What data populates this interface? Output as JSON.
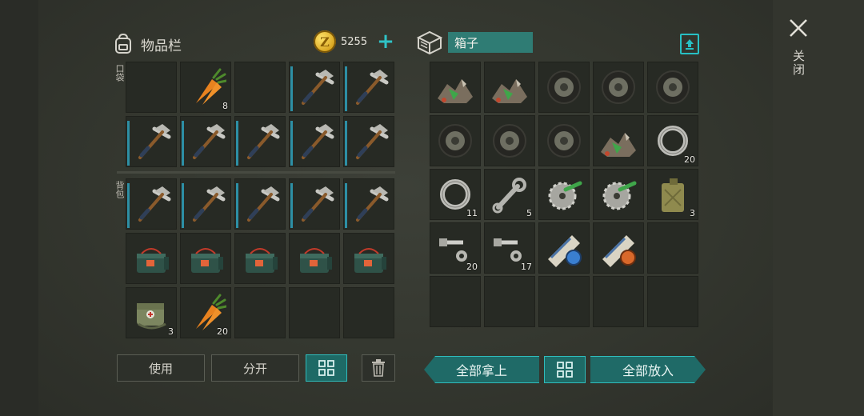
{
  "inventory": {
    "title": "物品栏",
    "coins": "5255",
    "pocket_label": "口袋",
    "backpack_label": "背包",
    "slots": [
      {
        "item": "",
        "count": ""
      },
      {
        "item": "carrot",
        "count": "8"
      },
      {
        "item": "",
        "count": ""
      },
      {
        "item": "pickaxe",
        "count": ""
      },
      {
        "item": "pickaxe",
        "count": ""
      },
      {
        "item": "pickaxe",
        "count": ""
      },
      {
        "item": "pickaxe",
        "count": ""
      },
      {
        "item": "pickaxe",
        "count": ""
      },
      {
        "item": "pickaxe",
        "count": ""
      },
      {
        "item": "pickaxe",
        "count": ""
      },
      {
        "item": "pickaxe",
        "count": ""
      },
      {
        "item": "pickaxe",
        "count": ""
      },
      {
        "item": "pickaxe",
        "count": ""
      },
      {
        "item": "pickaxe",
        "count": ""
      },
      {
        "item": "pickaxe",
        "count": ""
      },
      {
        "item": "battery-pack",
        "count": ""
      },
      {
        "item": "battery-pack",
        "count": ""
      },
      {
        "item": "battery-pack",
        "count": ""
      },
      {
        "item": "battery-pack",
        "count": ""
      },
      {
        "item": "battery-pack",
        "count": ""
      },
      {
        "item": "medkit-bag",
        "count": "3"
      },
      {
        "item": "carrot",
        "count": "20"
      },
      {
        "item": "",
        "count": ""
      },
      {
        "item": "",
        "count": ""
      },
      {
        "item": "",
        "count": ""
      }
    ],
    "buttons": {
      "use": "使用",
      "split": "分开"
    }
  },
  "box": {
    "title": "箱子",
    "slots": [
      {
        "item": "scrap-pile",
        "count": ""
      },
      {
        "item": "scrap-pile",
        "count": ""
      },
      {
        "item": "tire",
        "count": ""
      },
      {
        "item": "tire",
        "count": ""
      },
      {
        "item": "tire",
        "count": ""
      },
      {
        "item": "tire",
        "count": ""
      },
      {
        "item": "tire",
        "count": ""
      },
      {
        "item": "tire",
        "count": ""
      },
      {
        "item": "scrap-pile",
        "count": ""
      },
      {
        "item": "bearing",
        "count": "20"
      },
      {
        "item": "bearing",
        "count": "11"
      },
      {
        "item": "wrench",
        "count": "5"
      },
      {
        "item": "saw-blade",
        "count": ""
      },
      {
        "item": "saw-blade",
        "count": ""
      },
      {
        "item": "jerrycan",
        "count": "3"
      },
      {
        "item": "bolt-nut",
        "count": "20"
      },
      {
        "item": "bolt-nut",
        "count": "17"
      },
      {
        "item": "blueprint-blue",
        "count": ""
      },
      {
        "item": "blueprint-orange",
        "count": ""
      },
      {
        "item": "",
        "count": ""
      },
      {
        "item": "",
        "count": ""
      },
      {
        "item": "",
        "count": ""
      },
      {
        "item": "",
        "count": ""
      },
      {
        "item": "",
        "count": ""
      },
      {
        "item": "",
        "count": ""
      }
    ],
    "buttons": {
      "take_all": "全部拿上",
      "put_all": "全部放入"
    }
  },
  "close_label": "关闭",
  "colors": {
    "accent": "#2fbcbc",
    "slot": "#272a24",
    "durability": "#2d8fa5"
  }
}
